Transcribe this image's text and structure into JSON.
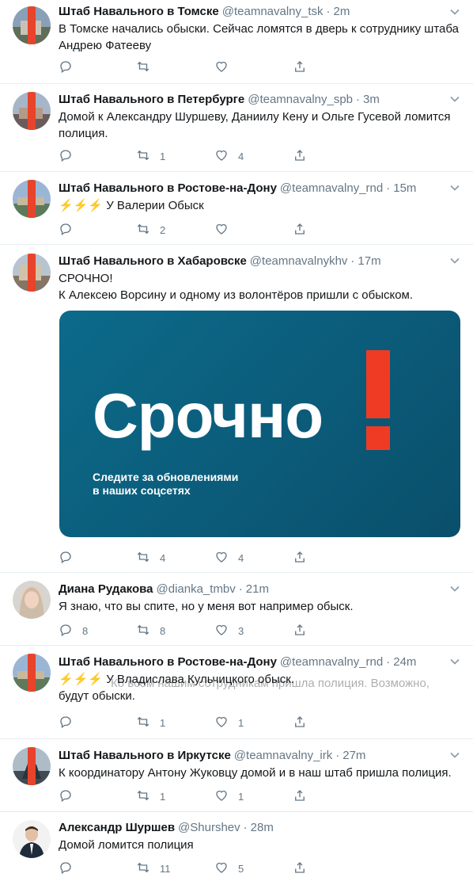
{
  "colors": {
    "accent": "#1da1f2",
    "muted": "#657786",
    "border": "#e6ecf0",
    "urgent_red": "#ef3b24",
    "urgent_bg": "#0b5a78"
  },
  "tweets": [
    {
      "name": "Штаб Навального в Томске",
      "handle": "@teamnavalny_tsk",
      "time": "2m",
      "text": "В Томске начались обыски. Сейчас ломятся в дверь к сотруднику штаба\nАндрею Фатееву",
      "reply_count": "",
      "retweet_count": "",
      "like_count": ""
    },
    {
      "name": "Штаб Навального в Петербурге",
      "handle": "@teamnavalny_spb",
      "time": "3m",
      "text": "Домой к Александру Шуршеву, Даниилу Кену и Ольге Гусевой ломится\nполиция.",
      "reply_count": "",
      "retweet_count": "1",
      "like_count": "4"
    },
    {
      "name": "Штаб Навального в Ростове-на-Дону",
      "handle": "@teamnavalny_rnd",
      "time": "15m",
      "text": "⚡⚡⚡ У Валерии Обыск",
      "reply_count": "",
      "retweet_count": "2",
      "like_count": ""
    },
    {
      "name": "Штаб Навального в Хабаровске",
      "handle": "@teamnavalnykhv",
      "time": "17m",
      "text": "СРОЧНО!\nК Алексею Ворсину и одному из волонтёров пришли с обыском.",
      "media_title": "Срочно",
      "media_subtitle": "Следите за обновлениями\nв наших соцсетях",
      "reply_count": "",
      "retweet_count": "4",
      "like_count": "4"
    },
    {
      "name": "Диана Рудакова",
      "handle": "@dianka_tmbv",
      "time": "21m",
      "text": "Я знаю, что вы спите, но у меня вот например обыск.",
      "reply_count": "8",
      "retweet_count": "8",
      "like_count": "3"
    },
    {
      "name": "Штаб Навального в Ростове-на-Дону",
      "handle": "@teamnavalny_rnd",
      "time": "24m",
      "text": "⚡⚡⚡ У Владислава Кульчицкого обыск.\nбудут обыски.",
      "overlap_text": "Ко всем нашим сотрудникам пришла полиция. Возможно,",
      "reply_count": "",
      "retweet_count": "1",
      "like_count": "1"
    },
    {
      "name": "Штаб Навального в Иркутске",
      "handle": "@teamnavalny_irk",
      "time": "27m",
      "text": "К координатору Антону Жуковцу домой и в наш штаб пришла полиция.",
      "reply_count": "",
      "retweet_count": "1",
      "like_count": "1"
    },
    {
      "name": "Александр Шуршев",
      "handle": "@Shurshev",
      "time": "28m",
      "text": "Домой ломится полиция",
      "reply_count": "",
      "retweet_count": "11",
      "like_count": "5"
    }
  ]
}
